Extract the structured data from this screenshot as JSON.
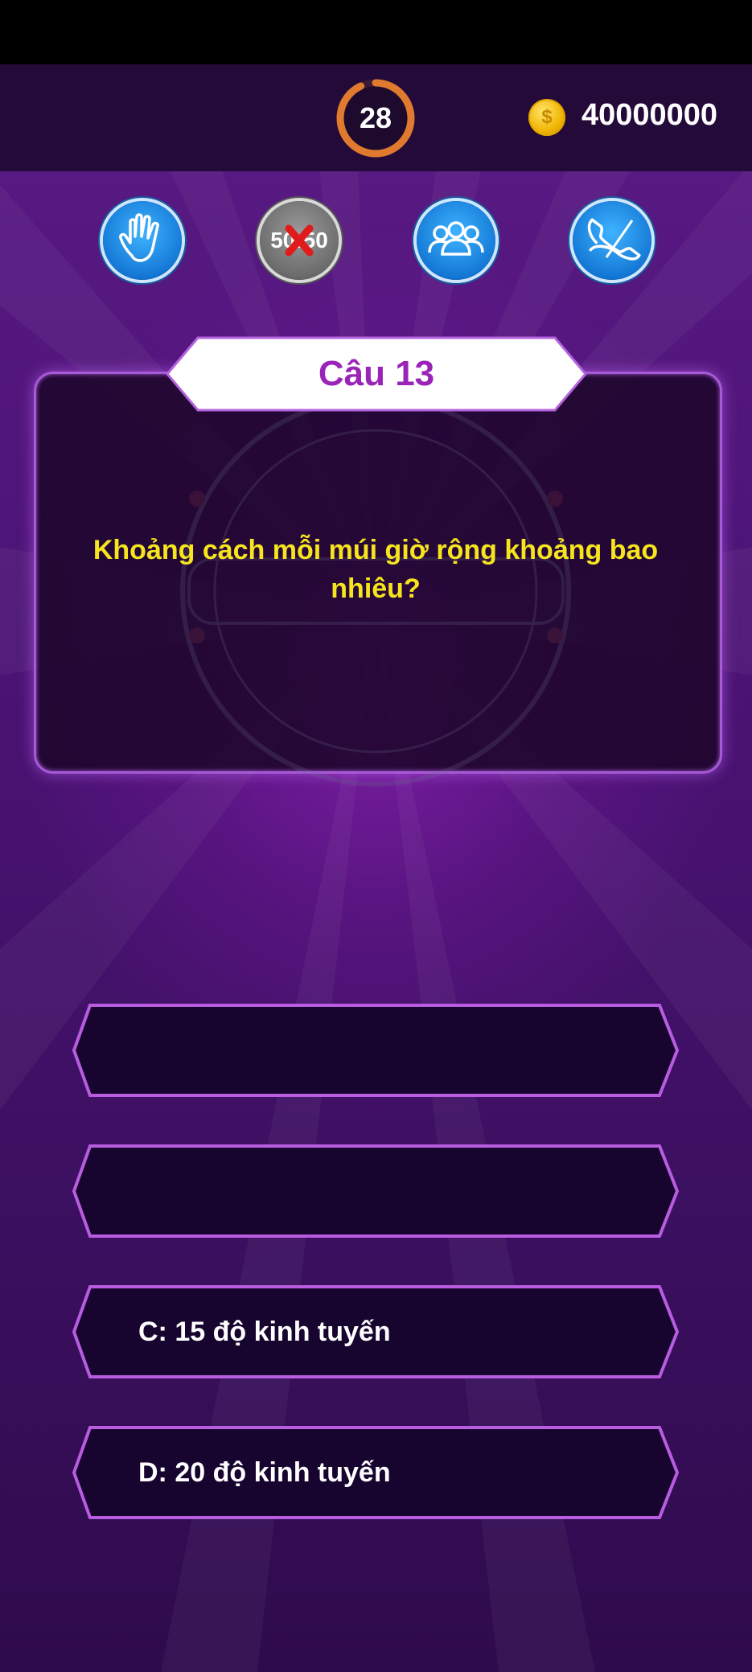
{
  "header": {
    "timer_value": "28",
    "timer_progress": 0.93,
    "coin_icon": "coin-icon",
    "coin_symbol": "$",
    "money": "40000000"
  },
  "lifelines": [
    {
      "name": "hand-icon",
      "used": false
    },
    {
      "name": "fifty-fifty-icon",
      "label": "50:50",
      "used": true
    },
    {
      "name": "audience-icon",
      "used": false
    },
    {
      "name": "phone-icon",
      "used": false
    }
  ],
  "question": {
    "number_label": "Câu 13",
    "text": "Khoảng cách mỗi múi giờ rộng khoảng bao nhiêu?"
  },
  "answers": [
    {
      "label": ""
    },
    {
      "label": ""
    },
    {
      "label": "C: 15 độ kinh tuyến"
    },
    {
      "label": "D: 20 độ kinh tuyến"
    }
  ],
  "colors": {
    "question_text": "#f6e51e",
    "number_label": "#9a24b8",
    "answer_border": "#b85ce0",
    "answer_fill": "#170530"
  }
}
